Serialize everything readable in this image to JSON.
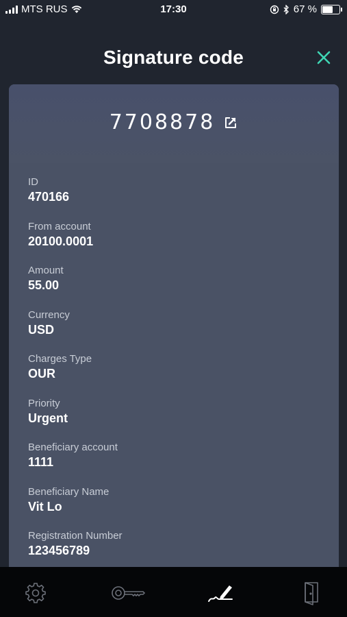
{
  "status_bar": {
    "carrier": "MTS RUS",
    "time": "17:30",
    "battery_percent": "67 %",
    "battery_level": 0.67
  },
  "header": {
    "title": "Signature code",
    "close_icon": "close-icon"
  },
  "signature": {
    "code": "7708878",
    "share_icon": "share-icon"
  },
  "fields": [
    {
      "label": "ID",
      "value": "470166"
    },
    {
      "label": "From account",
      "value": "20100.0001"
    },
    {
      "label": "Amount",
      "value": "55.00"
    },
    {
      "label": "Currency",
      "value": "USD"
    },
    {
      "label": "Charges Type",
      "value": "OUR"
    },
    {
      "label": "Priority",
      "value": "Urgent"
    },
    {
      "label": "Beneficiary account",
      "value": "1111"
    },
    {
      "label": "Beneficiary Name",
      "value": "Vit Lo"
    },
    {
      "label": "Registration Number",
      "value": "123456789"
    }
  ],
  "tab_bar": {
    "tabs": [
      "settings-icon",
      "key-icon",
      "signature-icon",
      "exit-door-icon"
    ],
    "active_tab": "signature-icon"
  },
  "colors": {
    "background": "#20252f",
    "card": "#4a5265",
    "accent": "#3fd6b4",
    "tab_bar": "#050608"
  }
}
